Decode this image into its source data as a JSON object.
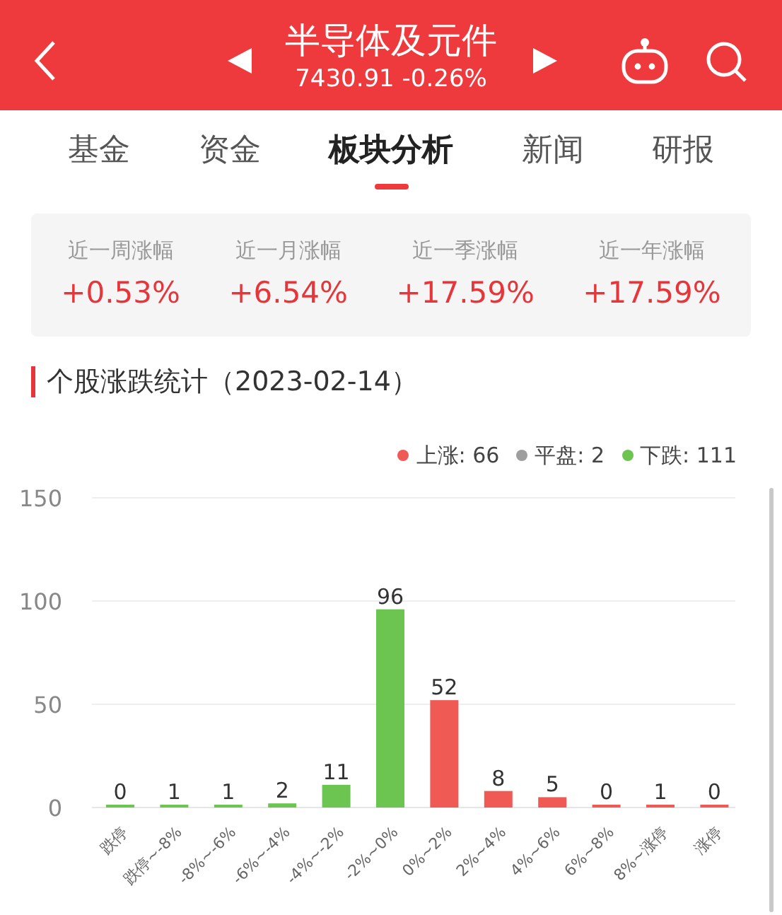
{
  "header": {
    "title": "半导体及元件",
    "subtitle": "7430.91 -0.26%"
  },
  "tabs": [
    {
      "label": "基金",
      "selected": false
    },
    {
      "label": "资金",
      "selected": false
    },
    {
      "label": "板块分析",
      "selected": true
    },
    {
      "label": "新闻",
      "selected": false
    },
    {
      "label": "研报",
      "selected": false
    }
  ],
  "stats": [
    {
      "label": "近一周涨幅",
      "value": "+0.53%"
    },
    {
      "label": "近一月涨幅",
      "value": "+6.54%"
    },
    {
      "label": "近一季涨幅",
      "value": "+17.59%"
    },
    {
      "label": "近一年涨幅",
      "value": "+17.59%"
    }
  ],
  "section_title": "个股涨跌统计（2023-02-14）",
  "legend": [
    {
      "label": "上涨: 66",
      "color": "#f05a55"
    },
    {
      "label": "平盘: 2",
      "color": "#9e9e9e"
    },
    {
      "label": "下跌: 111",
      "color": "#6cc551"
    }
  ],
  "chart_data": {
    "type": "bar",
    "categories": [
      "跌停",
      "跌停~-8%",
      "-8%~-6%",
      "-6%~-4%",
      "-4%~-2%",
      "-2%~0%",
      "0%~2%",
      "2%~4%",
      "4%~6%",
      "6%~8%",
      "8%~涨停",
      "涨停"
    ],
    "series": [
      {
        "color": "#6cc551",
        "values": [
          0,
          1,
          1,
          2,
          11,
          96,
          null,
          null,
          null,
          null,
          null,
          null
        ]
      },
      {
        "color": "#f05a55",
        "values": [
          null,
          null,
          null,
          null,
          null,
          null,
          52,
          8,
          5,
          0,
          1,
          0
        ]
      }
    ],
    "ylim": [
      0,
      150
    ],
    "yticks": [
      0,
      50,
      100,
      150
    ],
    "data_labels": true
  }
}
